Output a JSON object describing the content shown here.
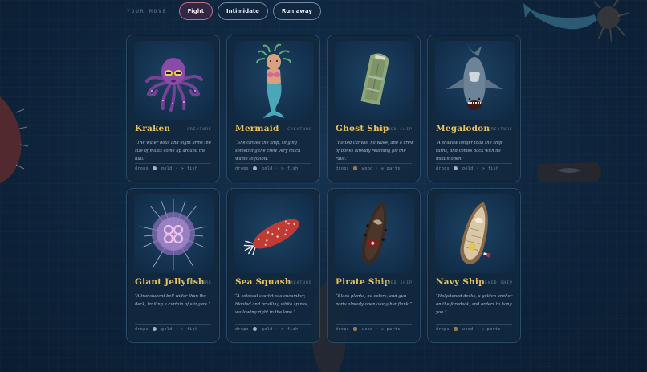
{
  "moves": {
    "label": "YOUR MOVE",
    "buttons": [
      {
        "label": "Fight",
        "active": true
      },
      {
        "label": "Intimidate",
        "active": false
      },
      {
        "label": "Run away",
        "active": false
      }
    ]
  },
  "cards": [
    {
      "name": "Kraken",
      "kind": "CREATURE",
      "desc": "“The water boils and eight arms the size of masts come up around the hull.”",
      "drops": {
        "prefix": "drops",
        "a": "gold",
        "sep": "·",
        "b": "fish"
      },
      "icon": "kraken-icon"
    },
    {
      "name": "Mermaid",
      "kind": "CREATURE",
      "desc": "“She circles the ship, singing something the crew very much wants to follow.”",
      "drops": {
        "prefix": "drops",
        "a": "gold",
        "sep": "·",
        "b": "fish"
      },
      "icon": "mermaid-icon"
    },
    {
      "name": "Ghost Ship",
      "kind": "CREWED SHIP",
      "desc": "“Rotted canvas, no wake, and a crew of bones already reaching for the rails.”",
      "drops": {
        "prefix": "drops",
        "a": "wood",
        "sep": "·",
        "b": "parts"
      },
      "icon": "ghost-ship-icon"
    },
    {
      "name": "Megalodon",
      "kind": "CREATURE",
      "desc": "“A shadow longer than the ship turns, and comes back with its mouth open.”",
      "drops": {
        "prefix": "drops",
        "a": "gold",
        "sep": "·",
        "b": "fish"
      },
      "icon": "megalodon-icon"
    },
    {
      "name": "Giant Jellyfish",
      "kind": "CREATURE",
      "desc": "“A translucent bell wider than the deck, trailing a curtain of stingers.”",
      "drops": {
        "prefix": "drops",
        "a": "gold",
        "sep": "·",
        "b": "fish"
      },
      "icon": "jellyfish-icon"
    },
    {
      "name": "Sea Squash",
      "kind": "CREATURE",
      "desc": "“A colossal scarlet sea cucumber, bloated and bristling white spines, wallowing right in the lane.”",
      "drops": {
        "prefix": "drops",
        "a": "gold",
        "sep": "·",
        "b": "fish"
      },
      "icon": "sea-squash-icon"
    },
    {
      "name": "Pirate Ship",
      "kind": "CREWED SHIP",
      "desc": "“Black planks, no colors, and gun ports already open along her flank.”",
      "drops": {
        "prefix": "drops",
        "a": "wood",
        "sep": "·",
        "b": "parts"
      },
      "icon": "pirate-ship-icon"
    },
    {
      "name": "Navy Ship",
      "kind": "CREWED SHIP",
      "desc": "“Holystoned decks, a golden anchor on the foredeck, and orders to hang you.”",
      "drops": {
        "prefix": "drops",
        "a": "wood",
        "sep": "·",
        "b": "parts"
      },
      "icon": "navy-ship-icon"
    }
  ],
  "colors": {
    "title_gold": "#e6c25c",
    "background": "#0f2740",
    "active_border": "#c56f86"
  }
}
